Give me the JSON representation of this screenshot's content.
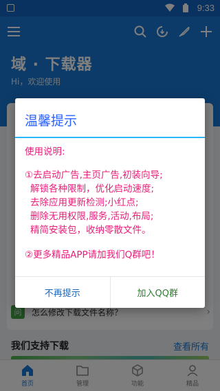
{
  "status_bar": {
    "time": "9:33"
  },
  "header": {
    "title": "域 · 下载器",
    "subtitle": "Hi，欢迎使用"
  },
  "faq": {
    "icon_text": "问",
    "text": "怎么修改下载文件名称？"
  },
  "section": {
    "title": "我们支持下载",
    "view_all": "查看所有"
  },
  "bottom_nav": {
    "items": [
      {
        "label": "首页",
        "icon": "home-icon"
      },
      {
        "label": "管理",
        "icon": "folder-icon"
      },
      {
        "label": "功能",
        "icon": "cube-icon"
      },
      {
        "label": "精品",
        "icon": "person-icon"
      }
    ]
  },
  "dialog": {
    "title": "温馨提示",
    "heading": "使用说明:",
    "lines": [
      "①去启动广告,主页广告,初装向导;",
      "解锁各种限制，优化启动速度;",
      "去除应用更新检测;小红点;",
      "删除无用权限,服务,活动,布局;",
      "精简安装包，收纳零散文件。"
    ],
    "footer_line": "②更多精品APP请加我们Q群吧！",
    "cancel_label": "不再提示",
    "confirm_label": "加入QQ群"
  },
  "colors": {
    "primary": "#1976d2",
    "dialog_title": "#2962ff",
    "dialog_text": "#e91e7a",
    "confirm": "#2e7d32",
    "divider": "#29b6f6"
  }
}
